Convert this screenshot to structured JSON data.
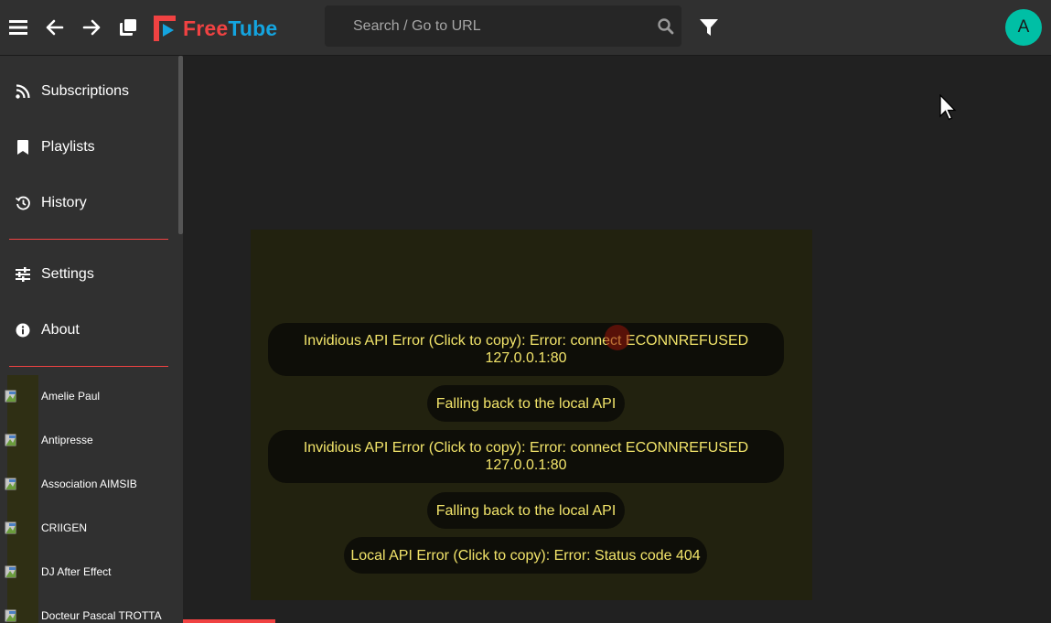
{
  "app": {
    "name_part1": "Free",
    "name_part2": "Tube"
  },
  "topbar": {
    "search_placeholder": "Search / Go to URL",
    "avatar_letter": "A"
  },
  "sidebar": {
    "nav": [
      {
        "label": "Subscriptions",
        "icon": "rss-icon"
      },
      {
        "label": "Playlists",
        "icon": "bookmark-icon"
      },
      {
        "label": "History",
        "icon": "history-icon"
      }
    ],
    "nav2": [
      {
        "label": "Settings",
        "icon": "sliders-icon"
      },
      {
        "label": "About",
        "icon": "info-icon"
      }
    ],
    "subscriptions": [
      "Amelie Paul",
      "Antipresse",
      "Association AIMSIB",
      "CRIIGEN",
      "DJ After Effect",
      "Docteur Pascal TROTTA"
    ]
  },
  "toasts": [
    "Invidious API Error (Click to copy): Error: connect ECONNREFUSED 127.0.0.1:80",
    "Falling back to the local API",
    "Invidious API Error (Click to copy): Error: connect ECONNREFUSED 127.0.0.1:80",
    "Falling back to the local API",
    "Local API Error (Click to copy): Error: Status code 404"
  ],
  "colors": {
    "accent_red": "#f04242",
    "accent_blue": "#14a4df",
    "avatar_bg": "#00bfa5",
    "toast_text": "#f2e46a"
  }
}
